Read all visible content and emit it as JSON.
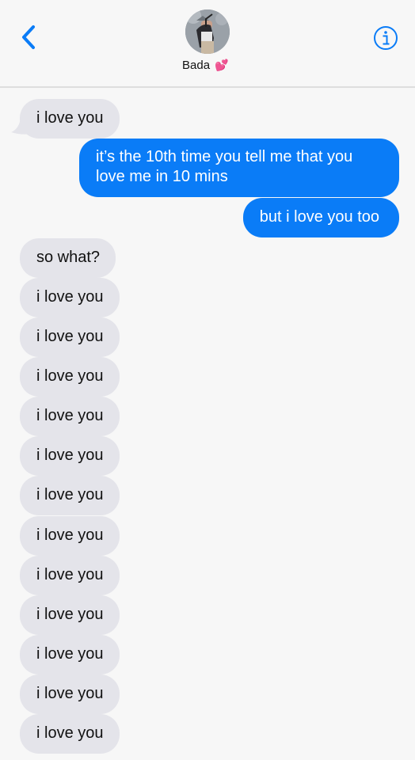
{
  "header": {
    "contact_name": "Bada",
    "contact_emoji": "💕",
    "back_icon": "chevron-left-icon",
    "info_icon": "info-icon",
    "accent_color": "#0a7cf7"
  },
  "messages": [
    {
      "side": "incoming",
      "text": "i love you"
    },
    {
      "side": "outgoing",
      "text": "it’s the 10th time you tell me that you love me in 10 mins"
    },
    {
      "side": "outgoing",
      "text": "but i love you too"
    },
    {
      "side": "incoming",
      "text": "so what?"
    },
    {
      "side": "incoming",
      "text": "i love you"
    },
    {
      "side": "incoming",
      "text": "i love you"
    },
    {
      "side": "incoming",
      "text": "i love you"
    },
    {
      "side": "incoming",
      "text": "i love you"
    },
    {
      "side": "incoming",
      "text": "i love you"
    },
    {
      "side": "incoming",
      "text": "i love you"
    },
    {
      "side": "incoming",
      "text": "i love you"
    },
    {
      "side": "incoming",
      "text": "i love you"
    },
    {
      "side": "incoming",
      "text": "i love you"
    },
    {
      "side": "incoming",
      "text": "i love you"
    },
    {
      "side": "incoming",
      "text": "i love you"
    },
    {
      "side": "incoming",
      "text": "i love you"
    }
  ]
}
